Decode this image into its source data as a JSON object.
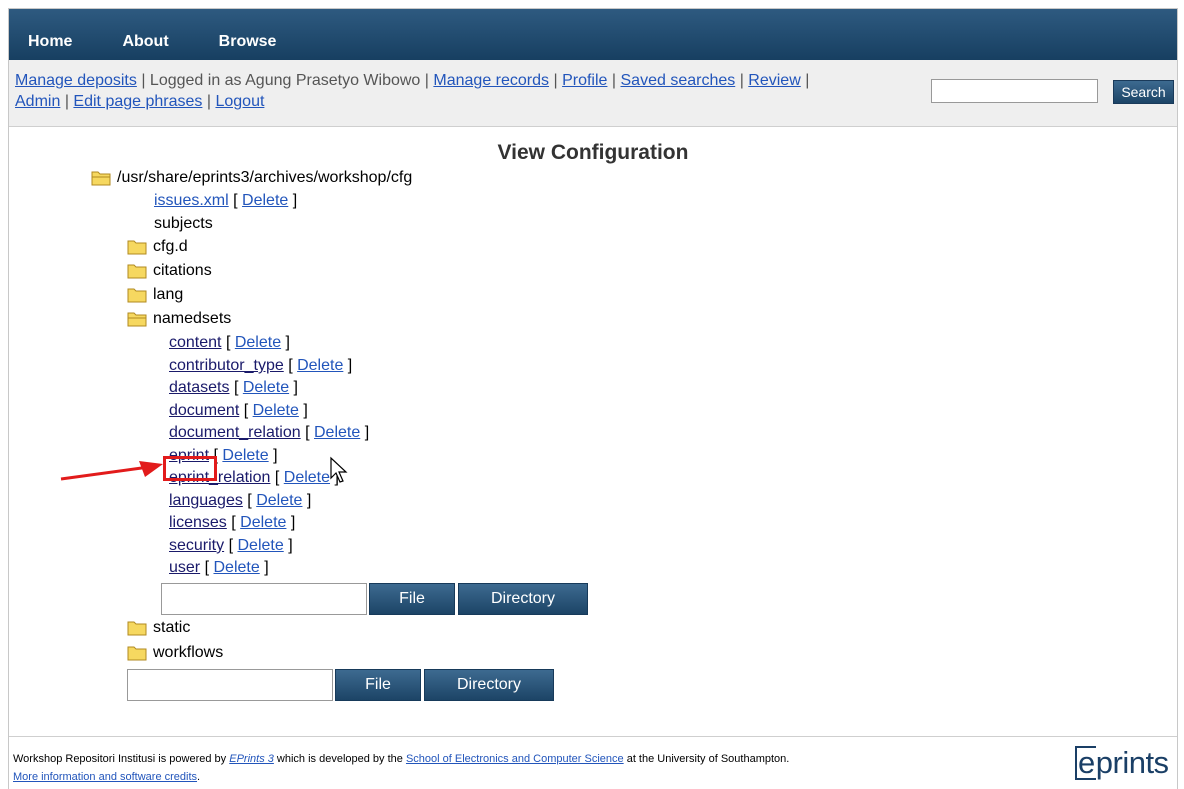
{
  "nav": {
    "home": "Home",
    "about": "About",
    "browse": "Browse"
  },
  "userbar": {
    "manage_deposits": "Manage deposits",
    "logged_in": "Logged in as Agung Prasetyo Wibowo",
    "manage_records": "Manage records",
    "profile": "Profile",
    "saved_searches": "Saved searches",
    "review": "Review",
    "admin": "Admin",
    "edit_phrases": "Edit page phrases",
    "logout": "Logout",
    "sep": "|"
  },
  "search": {
    "value": "",
    "button": "Search"
  },
  "page_title": "View Configuration",
  "tree": {
    "root": "/usr/share/eprints3/archives/workshop/cfg",
    "issues": "issues.xml",
    "subjects": "subjects",
    "folders": {
      "cfgd": "cfg.d",
      "citations": "citations",
      "lang": "lang",
      "namedsets": "namedsets",
      "static": "static",
      "workflows": "workflows"
    },
    "namedsets_files": [
      "content",
      "contributor_type",
      "datasets",
      "document",
      "document_relation",
      "eprint",
      "eprint_relation",
      "languages",
      "licenses",
      "security",
      "user"
    ],
    "delete": "Delete",
    "bracket_open": "[",
    "bracket_close": "]"
  },
  "controls": {
    "file": "File",
    "directory": "Directory"
  },
  "footer": {
    "t1": "Workshop Repositori Institusi is powered by ",
    "eprints3": "EPrints 3",
    "t2": " which is developed by the ",
    "school": "School of Electronics and Computer Science",
    "t3": " at the University of Southampton.",
    "more": "More information and software credits",
    "t4": "."
  },
  "logo": {
    "e": "e",
    "rest": "prints"
  },
  "colors": {
    "nav_bg": "#1f4a70",
    "link": "#2255bb",
    "highlight": "#e21b1b",
    "folder": "#f6d860"
  }
}
